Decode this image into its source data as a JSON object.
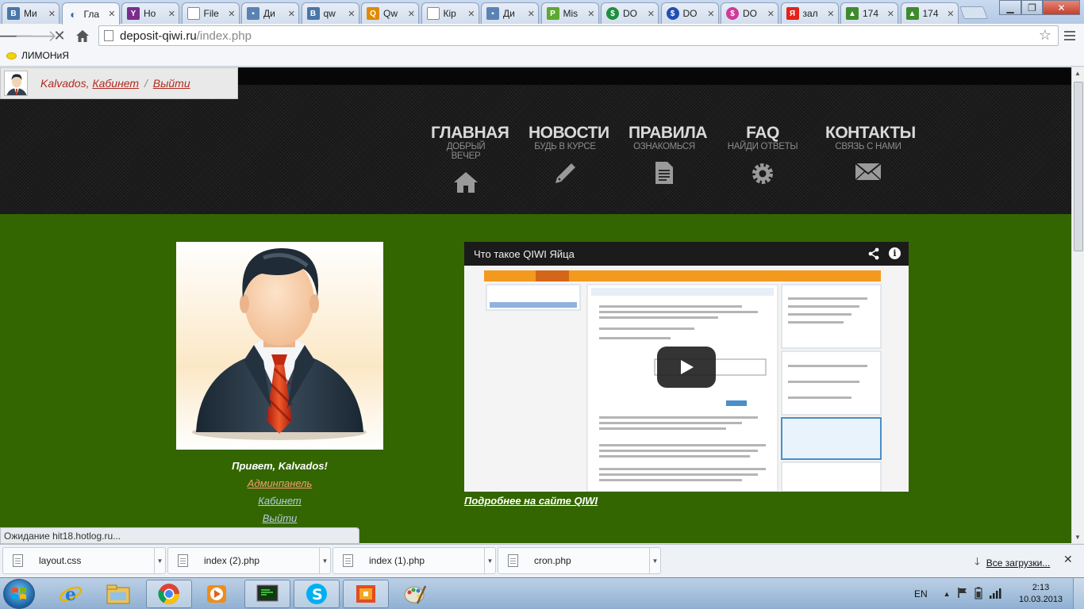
{
  "browser": {
    "tabs": [
      {
        "label": "Ми",
        "favicon": "vk-icon",
        "color": "#4a76a8"
      },
      {
        "label": "Гла",
        "favicon": "loading-spinner-icon",
        "color": "#3a66b5"
      },
      {
        "label": "Ho",
        "favicon": "yahoo-icon",
        "color": "#7b2d8e"
      },
      {
        "label": "File",
        "favicon": "page-icon",
        "color": "#ffffff"
      },
      {
        "label": "Ди",
        "favicon": "chat-bubble-icon",
        "color": "#5b82b4"
      },
      {
        "label": "qw",
        "favicon": "vk-icon",
        "color": "#4a76a8"
      },
      {
        "label": "Qw",
        "favicon": "qiwi-icon",
        "color": "#e08a00"
      },
      {
        "label": "Кір",
        "favicon": "page-icon",
        "color": "#ffffff"
      },
      {
        "label": "Ди",
        "favicon": "chat-bubble-icon",
        "color": "#5b82b4"
      },
      {
        "label": "Mis",
        "favicon": "payment-icon",
        "color": "#5da830"
      },
      {
        "label": "DO",
        "favicon": "dollar-green-icon",
        "color": "#1e8f3c"
      },
      {
        "label": "DO",
        "favicon": "dollar-blue-icon",
        "color": "#1f4fb5"
      },
      {
        "label": "DO",
        "favicon": "dollar-pink-icon",
        "color": "#d0399a"
      },
      {
        "label": "зал",
        "favicon": "yandex-icon",
        "color": "#e3231b"
      },
      {
        "label": "174",
        "favicon": "image-icon",
        "color": "#3e8b2e"
      },
      {
        "label": "174",
        "favicon": "image-icon",
        "color": "#3e8b2e"
      }
    ],
    "address": {
      "host": "deposit-qiwi.ru",
      "path": "/index.php"
    },
    "bookmarks": [
      {
        "label": "ЛИМОНиЯ"
      }
    ],
    "status_text": "Ожидание hit18.hotlog.ru...",
    "downloads": {
      "items": [
        {
          "name": "layout.css"
        },
        {
          "name": "index (2).php"
        },
        {
          "name": "index (1).php"
        },
        {
          "name": "cron.php"
        }
      ],
      "all_label": "Все загрузки..."
    }
  },
  "site": {
    "userbar": {
      "username": "Kalvados",
      "cabinet": "Кабинет",
      "separator": "/",
      "logout": "Выйти"
    },
    "nav": [
      {
        "title": "ГЛАВНАЯ",
        "subtitle": "ДОБРЫЙ ВЕЧЕР",
        "icon": "home-icon"
      },
      {
        "title": "НОВОСТИ",
        "subtitle": "БУДЬ В КУРСЕ",
        "icon": "pencil-icon"
      },
      {
        "title": "ПРАВИЛА",
        "subtitle": "ОЗНАКОМЬСЯ",
        "icon": "document-icon"
      },
      {
        "title": "FAQ",
        "subtitle": "НАЙДИ ОТВЕТЫ",
        "icon": "gear-icon"
      },
      {
        "title": "КОНТАКТЫ",
        "subtitle": "СВЯЗЬ С НАМИ",
        "icon": "envelope-icon"
      }
    ],
    "profile": {
      "greeting": "Привет, Kalvados!",
      "admin_link": "Админпанель",
      "cabinet_link": "Кабинет",
      "logout_link": "Выйти"
    },
    "video": {
      "title": "Что такое QIWI Яйца",
      "more_link": "Подробнее на сайте QIWI"
    },
    "colors": {
      "content_bg": "#336600",
      "admin_link": "#f29c74",
      "link": "#b9cde4",
      "userbar_link": "#b02a1e"
    }
  },
  "taskbar": {
    "apps": [
      "start-orb",
      "ie-icon",
      "explorer-icon",
      "chrome-icon",
      "media-player-icon",
      "terminal-icon",
      "skype-icon",
      "photo-app-icon",
      "paint-icon"
    ],
    "language": "EN",
    "time": "2:13",
    "date": "10.03.2013"
  }
}
